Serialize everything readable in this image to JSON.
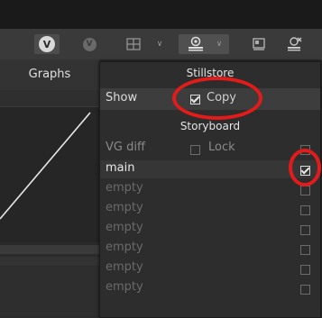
{
  "left_panel": {
    "title": "Graphs"
  },
  "stillstore": {
    "header": "Stillstore",
    "show_label": "Show",
    "copy_label": "Copy"
  },
  "storyboard": {
    "header": "Storyboard",
    "vg_diff_label": "VG diff",
    "lock_label": "Lock",
    "rows": [
      {
        "label": "main",
        "checked": true
      },
      {
        "label": "empty",
        "checked": false
      },
      {
        "label": "empty",
        "checked": false
      },
      {
        "label": "empty",
        "checked": false
      },
      {
        "label": "empty",
        "checked": false
      },
      {
        "label": "empty",
        "checked": false
      },
      {
        "label": "empty",
        "checked": false
      }
    ]
  },
  "toolbar": {
    "icons": [
      "v-scope-icon",
      "v-scope-secondary-icon",
      "grid-icon",
      "chevron-down-icon",
      "stillstore-icon",
      "chevron-down-icon",
      "monitor-icon",
      "stillstore-remove-icon"
    ]
  },
  "colors": {
    "highlight_ring": "#e21b1b",
    "background": "#2b2b2b"
  }
}
